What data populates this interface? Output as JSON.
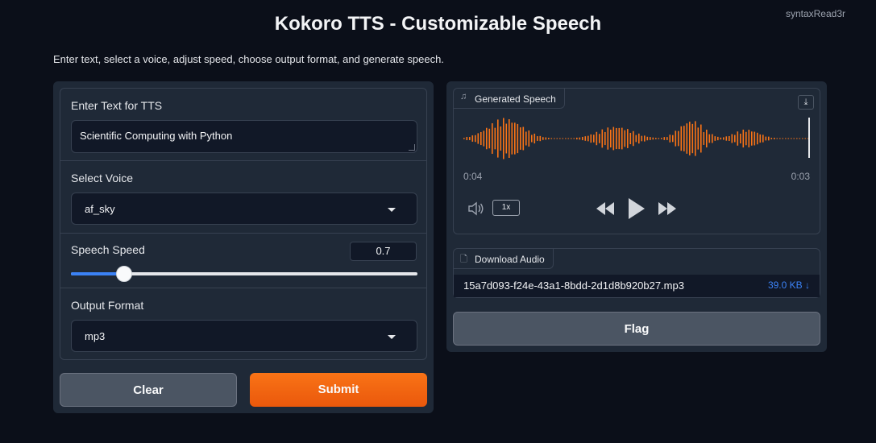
{
  "header": {
    "title": "Kokoro TTS - Customizable Speech",
    "user": "syntaxRead3r",
    "description": "Enter text, select a voice, adjust speed, choose output format, and generate speech."
  },
  "form": {
    "text_label": "Enter Text for TTS",
    "text_value": "Scientific Computing with Python",
    "voice_label": "Select Voice",
    "voice_value": "af_sky",
    "speed_label": "Speech Speed",
    "speed_value": "0.7",
    "speed_fraction": 0.153,
    "format_label": "Output Format",
    "format_value": "mp3"
  },
  "buttons": {
    "clear": "Clear",
    "submit": "Submit",
    "flag": "Flag"
  },
  "audio": {
    "label": "Generated Speech",
    "time_current": "0:04",
    "time_remaining": "0:03",
    "playback_rate": "1x"
  },
  "download": {
    "label": "Download Audio",
    "file_name": "15a7d093-f24e-43a1-8bdd-2d1d8b920b27.mp3",
    "file_size": "39.0 KB",
    "size_arrow": "↓"
  },
  "colors": {
    "waveform": "#f97316",
    "accent_orange": "#ea580c",
    "slider_blue": "#3b82f6",
    "background": "#0b0f19",
    "panel": "#1f2937"
  },
  "icons": {
    "audio_tab": "music-note-icon",
    "download_tab": "file-icon",
    "volume": "volume-icon",
    "rewind": "rewind-icon",
    "play": "play-icon",
    "fast_forward": "fast-forward-icon",
    "download": "download-icon"
  }
}
